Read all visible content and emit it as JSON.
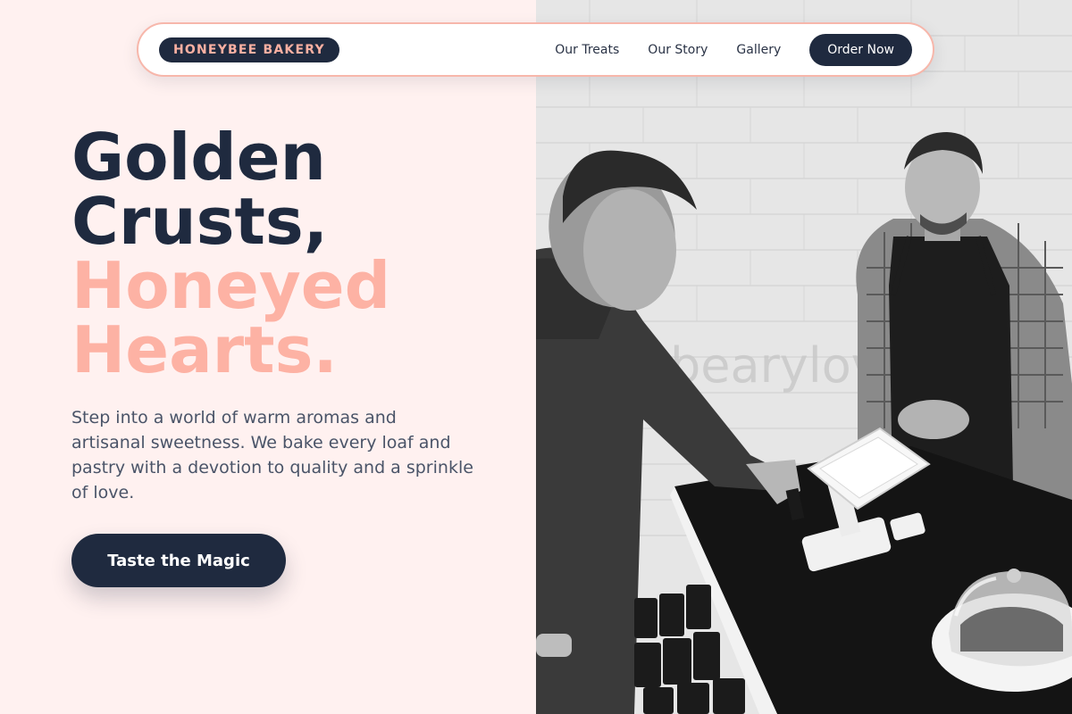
{
  "brand": {
    "name": "HONEYBEE BAKERY"
  },
  "nav": {
    "links": [
      "Our Treats",
      "Our Story",
      "Gallery"
    ],
    "order_button": "Order Now"
  },
  "hero": {
    "title_line1": "Golden",
    "title_line2": "Crusts,",
    "title_line3": "Honeyed",
    "title_line4": "Hearts.",
    "description": "Step into a world of warm aromas and artisanal sweetness. We bake every loaf and pastry with a devotion to quality and a sprinkle of love.",
    "cta": "Taste the Magic"
  },
  "photo": {
    "wall_sign": "bearylove",
    "alt": "grayscale photo of a customer paying at a bakery counter tablet while a barista in an apron looks on"
  },
  "colors": {
    "navy": "#1f2a3f",
    "accent": "#fdb2a4",
    "background": "#fff1f0",
    "body_text": "#4a5468"
  }
}
